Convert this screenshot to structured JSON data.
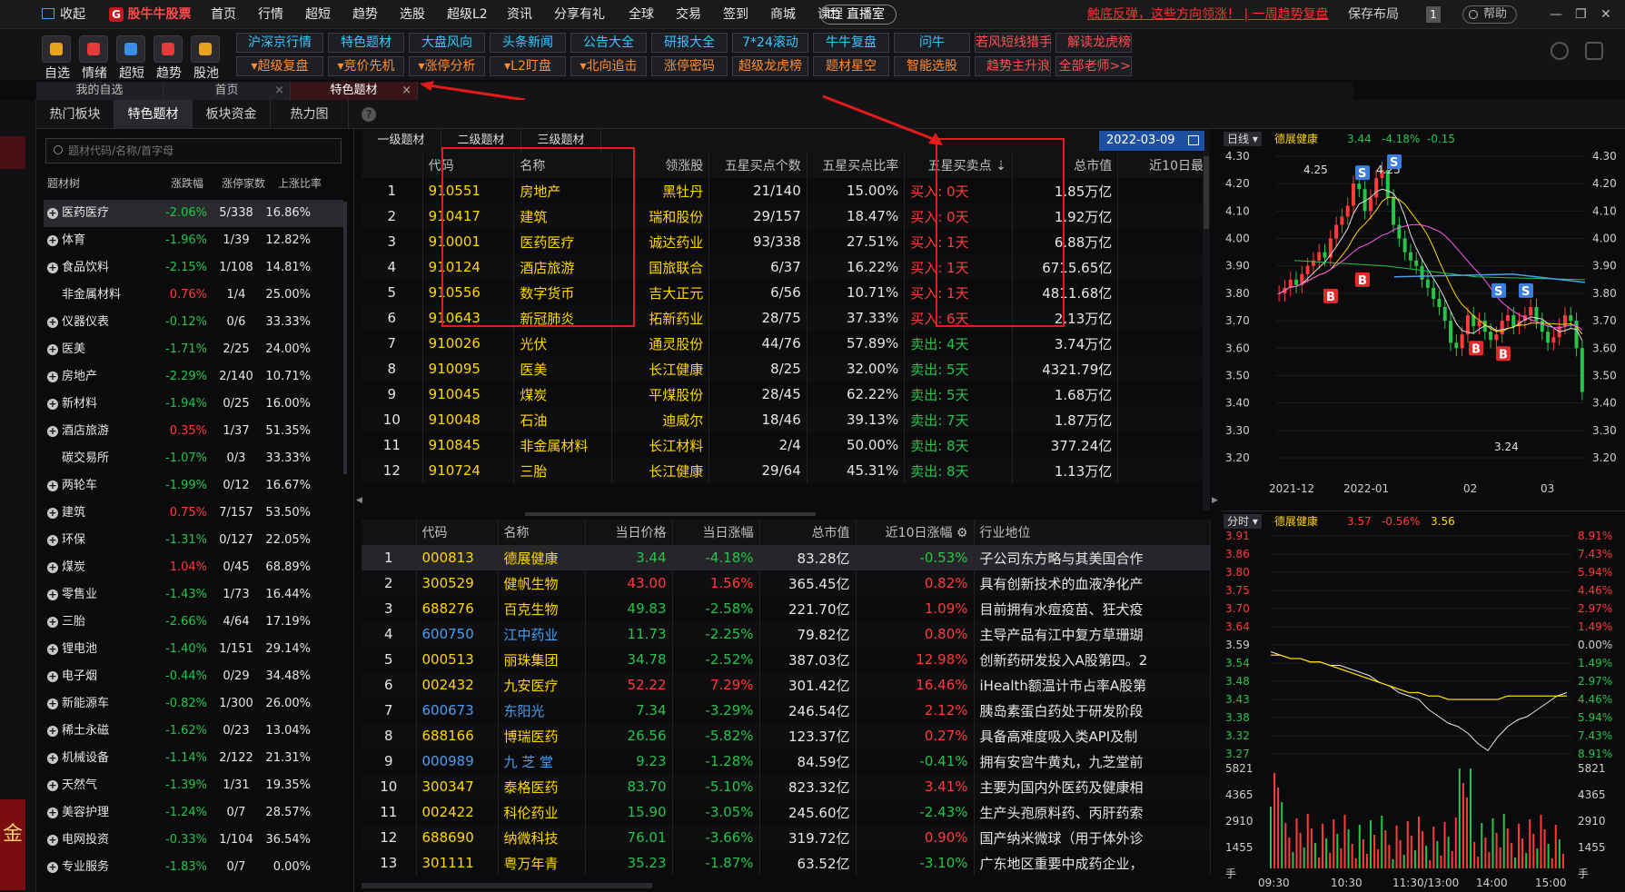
{
  "topbar": {
    "fav_label": "收起",
    "app_name": "股牛牛股票",
    "menu": [
      "首页",
      "行情",
      "超短",
      "趋势",
      "选股",
      "超级L2",
      "资讯",
      "分享有礼",
      "全球",
      "交易",
      "签到",
      "商城",
      "课程"
    ],
    "live_label": "直播室",
    "promo_text": "触底反弹，这些方向领涨！ | 一周趋势复盘",
    "save_layout": "保存布局",
    "badge": "1",
    "help": "帮助"
  },
  "toolbar": {
    "icons": [
      {
        "label": "自选",
        "icon": "plus-icon"
      },
      {
        "label": "情绪",
        "icon": "heart-icon"
      },
      {
        "label": "超短",
        "icon": "folder-icon"
      },
      {
        "label": "趋势",
        "icon": "ban-icon"
      },
      {
        "label": "股池",
        "icon": "chart-icon"
      }
    ],
    "row1": [
      "沪深京行情",
      "特色题材",
      "大盘风向",
      "头条新闻",
      "公告大全",
      "研报大全",
      "7*24滚动",
      "牛牛复盘",
      "问牛",
      "若风短线猎手",
      "解读龙虎榜"
    ],
    "row2": [
      "超级复盘",
      "竞价先机",
      "涨停分析",
      "L2盯盘",
      "北向追击",
      "涨停密码",
      "超级龙虎榜",
      "题材星空",
      "智能选股",
      "趋势主升浪",
      "全部老师>>"
    ]
  },
  "tabs": [
    "我的自选",
    "首页",
    "特色题材"
  ],
  "subtabs": [
    "热门板块",
    "特色题材",
    "板块资金",
    "热力图"
  ],
  "left": {
    "search_placeholder": "题材代码/名称/首字母",
    "headers": [
      "题材树",
      "涨跌幅",
      "涨停家数",
      "上涨比率"
    ],
    "rows": [
      [
        "医药医疗",
        "-2.06%",
        "5/338",
        "16.86%"
      ],
      [
        "体育",
        "-1.96%",
        "1/39",
        "12.82%"
      ],
      [
        "食品饮料",
        "-2.15%",
        "1/108",
        "14.81%"
      ],
      [
        "非金属材料",
        "0.76%",
        "1/4",
        "25.00%"
      ],
      [
        "仪器仪表",
        "-0.12%",
        "0/6",
        "33.33%"
      ],
      [
        "医美",
        "-1.71%",
        "2/25",
        "24.00%"
      ],
      [
        "房地产",
        "-2.29%",
        "2/140",
        "10.71%"
      ],
      [
        "新材料",
        "-1.94%",
        "0/25",
        "16.00%"
      ],
      [
        "酒店旅游",
        "0.35%",
        "1/37",
        "51.35%"
      ],
      [
        "碳交易所",
        "-1.07%",
        "0/3",
        "33.33%"
      ],
      [
        "两轮车",
        "-1.99%",
        "0/12",
        "16.67%"
      ],
      [
        "建筑",
        "0.75%",
        "7/157",
        "53.50%"
      ],
      [
        "环保",
        "-1.31%",
        "0/127",
        "22.05%"
      ],
      [
        "煤炭",
        "1.04%",
        "0/45",
        "68.89%"
      ],
      [
        "零售业",
        "-1.43%",
        "1/73",
        "16.44%"
      ],
      [
        "三胎",
        "-2.66%",
        "4/64",
        "17.19%"
      ],
      [
        "锂电池",
        "-1.40%",
        "1/151",
        "29.14%"
      ],
      [
        "电子烟",
        "-0.44%",
        "0/29",
        "34.48%"
      ],
      [
        "新能源车",
        "-0.82%",
        "1/300",
        "26.00%"
      ],
      [
        "稀土永磁",
        "-1.62%",
        "0/23",
        "13.04%"
      ],
      [
        "机械设备",
        "-1.14%",
        "2/122",
        "21.31%"
      ],
      [
        "天然气",
        "-1.39%",
        "1/31",
        "19.35%"
      ],
      [
        "美容护理",
        "-1.24%",
        "0/7",
        "28.57%"
      ],
      [
        "电网投资",
        "-0.33%",
        "1/104",
        "36.54%"
      ],
      [
        "专业服务",
        "-1.83%",
        "0/7",
        "0.00%"
      ]
    ]
  },
  "upper": {
    "tabs": [
      "一级题材",
      "二级题材",
      "三级题材"
    ],
    "date": "2022-03-09",
    "headers": [
      "代码",
      "名称",
      "领涨股",
      "五星买点个数",
      "五星买点比率",
      "五星买卖点",
      "总市值",
      "近10日最"
    ],
    "rows": [
      [
        "1",
        "910551",
        "房地产",
        "黑牡丹",
        "21/140",
        "15.00%",
        "买入: 0天",
        "1.85万亿"
      ],
      [
        "2",
        "910417",
        "建筑",
        "瑞和股份",
        "29/157",
        "18.47%",
        "买入: 0天",
        "1.92万亿"
      ],
      [
        "3",
        "910001",
        "医药医疗",
        "诚达药业",
        "93/338",
        "27.51%",
        "买入: 1天",
        "6.88万亿"
      ],
      [
        "4",
        "910124",
        "酒店旅游",
        "国旅联合",
        "6/37",
        "16.22%",
        "买入: 1天",
        "6715.65亿"
      ],
      [
        "5",
        "910556",
        "数字货币",
        "吉大正元",
        "6/56",
        "10.71%",
        "买入: 1天",
        "4811.68亿"
      ],
      [
        "6",
        "910643",
        "新冠肺炎",
        "拓新药业",
        "28/75",
        "37.33%",
        "买入: 6天",
        "2.13万亿"
      ],
      [
        "7",
        "910026",
        "光伏",
        "通灵股份",
        "44/76",
        "57.89%",
        "卖出: 4天",
        "3.74万亿"
      ],
      [
        "8",
        "910095",
        "医美",
        "长江健康",
        "8/25",
        "32.00%",
        "卖出: 5天",
        "4321.79亿"
      ],
      [
        "9",
        "910045",
        "煤炭",
        "平煤股份",
        "28/45",
        "62.22%",
        "卖出: 5天",
        "1.68万亿"
      ],
      [
        "10",
        "910048",
        "石油",
        "迪威尔",
        "18/46",
        "39.13%",
        "卖出: 7天",
        "1.87万亿"
      ],
      [
        "11",
        "910845",
        "非金属材料",
        "长江材料",
        "2/4",
        "50.00%",
        "卖出: 8天",
        "377.24亿"
      ],
      [
        "12",
        "910724",
        "三胎",
        "长江健康",
        "29/64",
        "45.31%",
        "卖出: 8天",
        "1.13万亿"
      ]
    ]
  },
  "lower": {
    "headers": [
      "代码",
      "名称",
      "当日价格",
      "当日涨幅",
      "总市值",
      "近10日涨幅",
      "行业地位"
    ],
    "rows": [
      [
        "1",
        "000813",
        "德展健康",
        "3.44",
        "-4.18%",
        "83.28亿",
        "-0.53%",
        "子公司东方略与其美国合作"
      ],
      [
        "2",
        "300529",
        "健帆生物",
        "43.00",
        "1.56%",
        "365.45亿",
        "0.82%",
        "具有创新技术的血液净化产"
      ],
      [
        "3",
        "688276",
        "百克生物",
        "49.83",
        "-2.58%",
        "221.70亿",
        "1.09%",
        "目前拥有水痘疫苗、狂犬疫"
      ],
      [
        "4",
        "600750",
        "江中药业",
        "11.73",
        "-2.25%",
        "79.82亿",
        "0.80%",
        "主导产品有江中复方草珊瑚"
      ],
      [
        "5",
        "000513",
        "丽珠集团",
        "34.78",
        "-2.52%",
        "387.03亿",
        "12.98%",
        "创新药研发投入A股第四。2"
      ],
      [
        "6",
        "002432",
        "九安医疗",
        "52.22",
        "7.29%",
        "301.42亿",
        "16.46%",
        "iHealth额温计市占率A股第"
      ],
      [
        "7",
        "600673",
        "东阳光",
        "7.34",
        "-3.29%",
        "246.54亿",
        "2.12%",
        "胰岛素蛋白药处于研发阶段"
      ],
      [
        "8",
        "688166",
        "博瑞医药",
        "26.56",
        "-5.82%",
        "123.37亿",
        "0.27%",
        "具备高难度吸入类API及制"
      ],
      [
        "9",
        "000989",
        "九 芝 堂",
        "9.23",
        "-1.28%",
        "84.59亿",
        "-0.41%",
        "拥有安宫牛黄丸，九芝堂前"
      ],
      [
        "10",
        "300347",
        "泰格医药",
        "83.70",
        "-5.10%",
        "823.32亿",
        "3.41%",
        "主要为国内外医药及健康相"
      ],
      [
        "11",
        "002422",
        "科伦药业",
        "15.90",
        "-3.05%",
        "245.60亿",
        "-2.43%",
        "生产头孢原料药、丙肝药索"
      ],
      [
        "12",
        "688690",
        "纳微科技",
        "76.01",
        "-3.66%",
        "319.72亿",
        "0.90%",
        "国产纳米微球（用于体外诊"
      ],
      [
        "13",
        "301111",
        "粤万年青",
        "35.23",
        "-1.87%",
        "63.52亿",
        "-3.10%",
        "广东地区重要中成药企业，"
      ]
    ]
  },
  "kline": {
    "period": "日线",
    "name": "德展健康",
    "price": "3.44",
    "chg": "-4.18%",
    "diff": "-0.15",
    "yticks": [
      "4.30",
      "4.20",
      "4.10",
      "4.00",
      "3.90",
      "3.80",
      "3.70",
      "3.60",
      "3.50",
      "3.40",
      "3.30",
      "3.20"
    ],
    "xticks": [
      "2021-12",
      "2022-01",
      "02",
      "03"
    ],
    "hi_label": "4.25",
    "hi2_label": "4.25",
    "lo_label": "3.24",
    "markers": [
      "S",
      "S",
      "B",
      "B",
      "S",
      "S",
      "B",
      "B"
    ]
  },
  "intraday": {
    "period": "分时",
    "name": "德展健康",
    "price": "3.57",
    "chg": "-0.56%",
    "avg": "3.56",
    "yticks": [
      "3.91",
      "3.86",
      "3.80",
      "3.75",
      "3.70",
      "3.64",
      "3.59",
      "3.54",
      "3.48",
      "3.43",
      "3.38",
      "3.32",
      "3.27"
    ],
    "pct": [
      "8.91%",
      "7.43%",
      "5.94%",
      "4.46%",
      "2.97%",
      "1.49%",
      "0.00%",
      "1.49%",
      "2.97%",
      "4.46%",
      "5.94%",
      "7.43%",
      "8.91%"
    ],
    "vol": [
      "5821",
      "4365",
      "2910",
      "1455",
      "手"
    ],
    "xticks": [
      "09:30",
      "10:30",
      "11:30/13:00",
      "14:00",
      "15:00"
    ]
  },
  "colors": {
    "red": "#ff3b3b",
    "green": "#27c44a",
    "yellow": "#ffd700",
    "cyan": "#33c8ff"
  }
}
